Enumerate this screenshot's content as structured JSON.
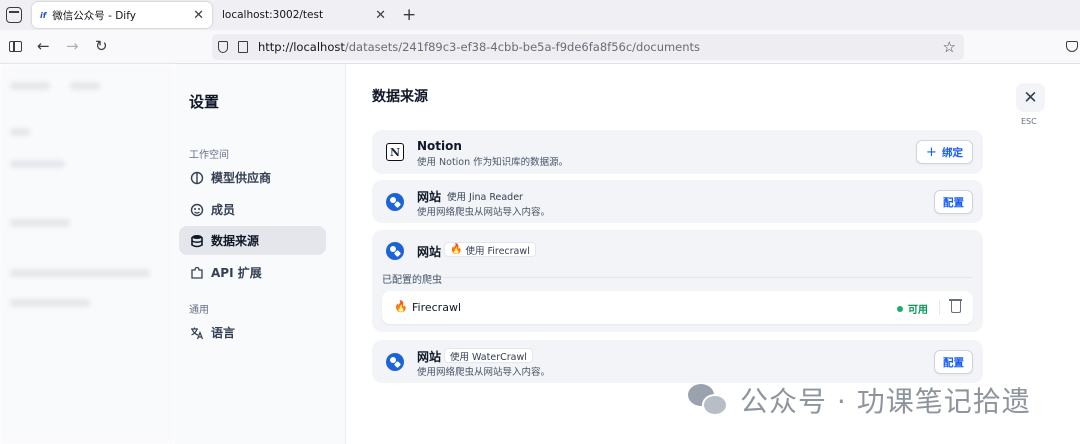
{
  "browser": {
    "tabs": [
      {
        "favicon": "if",
        "title": "微信公众号 - Dify",
        "active": true
      },
      {
        "title": "localhost:3002/test",
        "active": false
      }
    ],
    "url_host": "http://localhost",
    "url_path": "/datasets/241f89c3-ef38-4cbb-be5a-f9de6fa8f56c/documents"
  },
  "settings": {
    "title": "设置",
    "workspace_label": "工作空间",
    "general_label": "通用",
    "menu": [
      {
        "label": "模型供应商",
        "icon": "brain-icon"
      },
      {
        "label": "成员",
        "icon": "members-icon"
      },
      {
        "label": "数据来源",
        "icon": "database-icon",
        "active": true
      },
      {
        "label": "API 扩展",
        "icon": "puzzle-icon"
      },
      {
        "label": "语言",
        "icon": "translate-icon"
      }
    ]
  },
  "main": {
    "title": "数据来源",
    "esc_label": "ESC",
    "notion": {
      "name": "Notion",
      "desc": "使用 Notion 作为知识库的数据源。",
      "button": "绑定",
      "button_icon": "+"
    },
    "jina": {
      "name": "网站",
      "badge": "使用 Jina Reader",
      "desc": "使用网络爬虫从网站导入内容。",
      "button": "配置"
    },
    "firecrawl": {
      "name": "网站",
      "badge": "使用 Firecrawl",
      "configured_label": "已配置的爬虫",
      "crawler_name": "Firecrawl",
      "status": "可用"
    },
    "watercrawl": {
      "name": "网站",
      "badge": "使用 WaterCrawl",
      "desc": "使用网络爬虫从网站导入内容。",
      "button": "配置"
    }
  },
  "watermark": {
    "text": "公众号 · 功课笔记拾遗"
  }
}
